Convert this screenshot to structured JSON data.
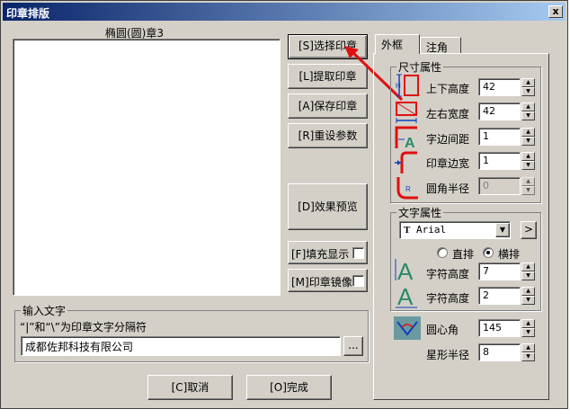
{
  "window": {
    "title": "印章排版",
    "close": "x"
  },
  "preview": {
    "caption": "椭圆(圆)章3"
  },
  "buttons": {
    "select_seal": "[S]选择印章",
    "extract_seal": "[L]提取印章",
    "save_seal": "[A]保存印章",
    "reset_params": "[R]重设参数",
    "preview_effect": "[D]效果预览",
    "fill_display": "[F]填充显示",
    "mirror_seal": "[M]印章镜像",
    "cancel": "[C]取消",
    "done": "[O]完成",
    "browse": "...",
    "font_more": ">"
  },
  "input_group": {
    "legend": "输入文字",
    "hint": "“|”和“\\”为印章文字分隔符",
    "text": "成都佐邦科技有限公司"
  },
  "tabs": [
    "外框",
    "注角"
  ],
  "size_group": {
    "legend": "尺寸属性",
    "rows": [
      {
        "label": "上下高度",
        "value": "42"
      },
      {
        "label": "左右宽度",
        "value": "42"
      },
      {
        "label": "字边间距",
        "value": "1"
      },
      {
        "label": "印章边宽",
        "value": "1"
      },
      {
        "label": "圆角半径",
        "value": "0"
      }
    ]
  },
  "text_group": {
    "legend": "文字属性",
    "font": "Arial",
    "font_icon_letter": "T",
    "radio_vertical": "直排",
    "radio_horizontal": "横排",
    "char_height_label": "字符高度",
    "char_height": "7",
    "char_width_label": "字符高度",
    "char_width": "2"
  },
  "extra": {
    "center_angle_label": "圆心角",
    "center_angle": "145",
    "star_radius_label": "星形半径",
    "star_radius": "8"
  },
  "icons": {
    "letter_A": "A",
    "letter_H": "H",
    "letter_W": "W",
    "letter_R": "R"
  },
  "colors": {
    "accent_red": "#e01010",
    "icon_blue": "#1040c0",
    "icon_green": "#2a8a6a"
  }
}
